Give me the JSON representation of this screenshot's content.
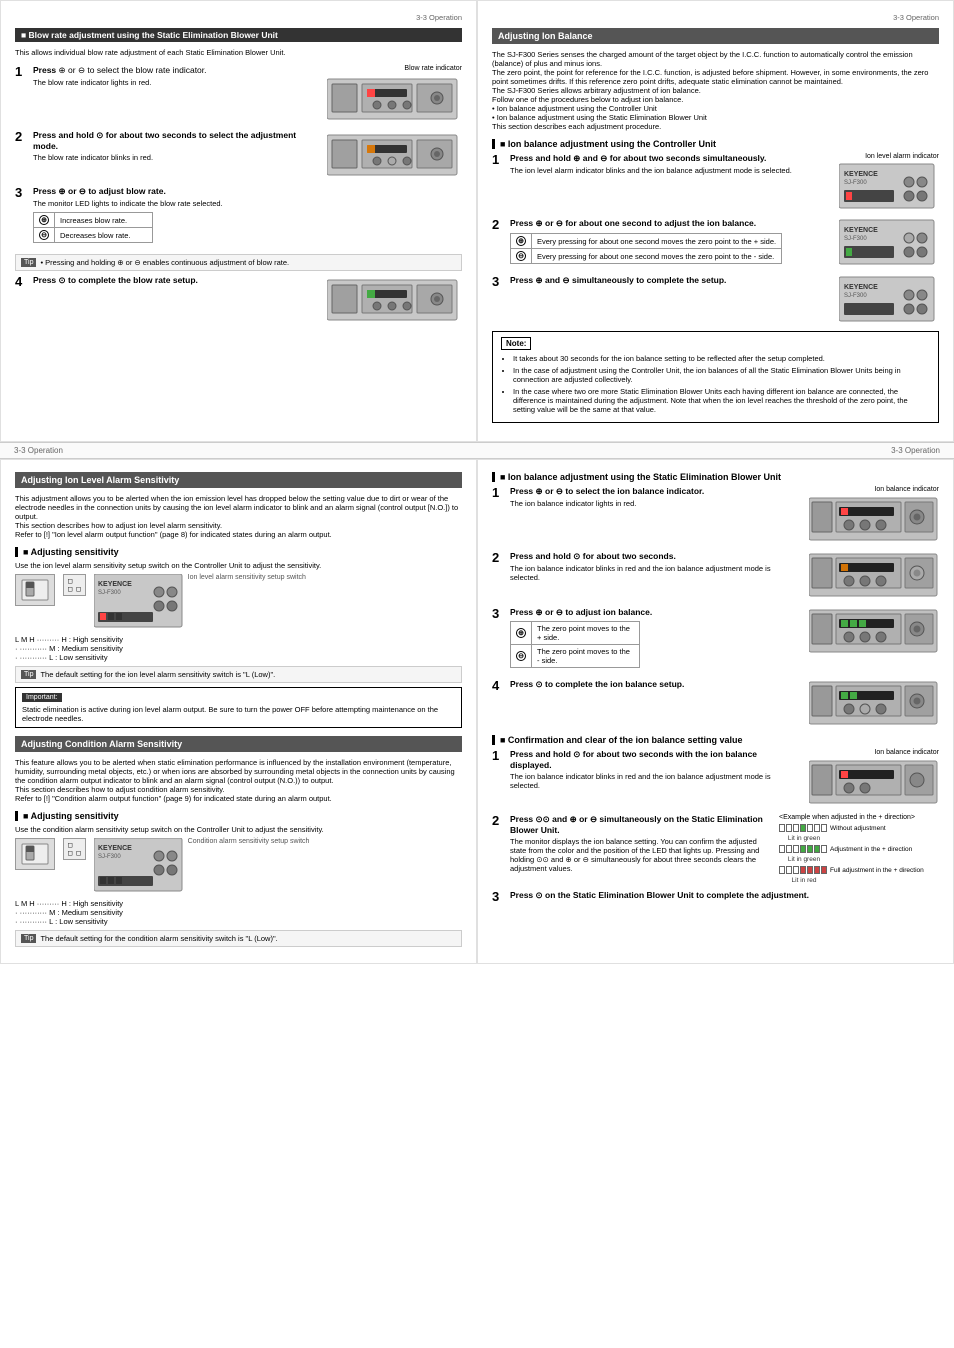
{
  "pages": {
    "top_left": {
      "header": "3-3  Operation",
      "section_title": "■ Blow rate adjustment using the Static Elimination Blower Unit",
      "section_desc": "This allows individual blow rate adjustment of each Static Elimination Blower Unit.",
      "blow_rate_indicator_label": "Blow rate indicator",
      "steps": [
        {
          "num": "1",
          "bold_text": "Press",
          "text": " ⊕ or ⊖ to select the blow rate indicator.",
          "sub": "The blow rate indicator lights in red."
        },
        {
          "num": "2",
          "bold_text": "Press and hold ⊙ for about two seconds to select the adjustment mode.",
          "text": "",
          "sub": "The blow rate indicator blinks in red."
        },
        {
          "num": "3",
          "bold_text": "Press ⊕ or ⊖ to adjust blow rate.",
          "text": "",
          "sub": "The monitor LED lights to indicate the blow rate selected."
        },
        {
          "num": "4",
          "bold_text": "Press ⊙ to complete the blow rate setup.",
          "text": "",
          "sub": ""
        }
      ],
      "table_rows": [
        {
          "icon": "⊕",
          "text": "Increases blow rate."
        },
        {
          "icon": "⊖",
          "text": "Decreases blow rate."
        }
      ],
      "tip_text": "• Pressing and holding ⊕ or ⊖ enables continuous adjustment of blow rate."
    },
    "top_right": {
      "header": "3-3  Operation",
      "section_title": "Adjusting Ion Balance",
      "section_desc_lines": [
        "The SJ-F300 Series senses the charged amount of the target object by the I.C.C. function to automatically control the emission (balance) of plus and minus ions.",
        "The zero point, the point for reference for the I.C.C. function, is adjusted before shipment. However, in some environments, the zero point sometimes drifts. If this reference zero point drifts, adequate static elimination cannot be maintained.",
        "The SJ-F300 Series allows arbitrary adjustment of ion balance.",
        "Follow one of the procedures below to adjust ion balance.",
        "• Ion balance adjustment using the Controller Unit",
        "• Ion balance adjustment using the Static Elimination Blower Unit",
        "This section describes each adjustment procedure."
      ],
      "controller_unit_title": "■ Ion balance adjustment using the Controller Unit",
      "controller_steps": [
        {
          "num": "1",
          "bold_text": "Press and hold ⊕ and ⊖ for about two seconds simultaneously.",
          "sub": "The ion level alarm indicator blinks and the ion balance adjustment mode is selected.",
          "indicator_label": "Ion level alarm indicator"
        },
        {
          "num": "2",
          "bold_text": "Press ⊕ or ⊖ for about one second to adjust the ion balance.",
          "sub": "",
          "table": [
            {
              "icon": "⊕",
              "text": "Every pressing for about one second moves the zero point to the + side."
            },
            {
              "icon": "⊖",
              "text": "Every pressing for about one second moves the zero point to the - side."
            }
          ]
        },
        {
          "num": "3",
          "bold_text": "Press ⊕ and ⊖ simultaneously to complete the setup.",
          "sub": ""
        }
      ],
      "note_title": "Note:",
      "note_bullets": [
        "It takes about 30 seconds for the ion balance setting to be reflected after the setup completed.",
        "In the case of adjustment using the Controller Unit, the ion balances of all the Static Elimination Blower Units being in connection are adjusted collectively.",
        "In the case where two ore more Static Elimination Blower Units each having different ion balance are connected, the difference is maintained during the adjustment. Note that when the ion level reaches the threshold of the zero point, the setting value will be the same at that value."
      ]
    },
    "middle_header_left": "3-3  Operation",
    "middle_header_right": "3-3  Operation",
    "bottom_left": {
      "section1_title": "Adjusting Ion Level Alarm Sensitivity",
      "section1_desc": "This adjustment allows you to be alerted when the ion emission level has dropped below the setting value due to dirt or wear of the electrode needles in the connection units by causing the ion level alarm indicator to blink and an alarm signal (control output [N.O.]) to output.\nThis section describes how to adjust ion level alarm sensitivity.\nRefer to [!] \"Ion level alarm output function\" (page 8) for indicated states during an alarm output.",
      "adj_sens_title": "■ Adjusting sensitivity",
      "adj_sens_desc": "Use the ion level alarm sensitivity setup switch on the Controller Unit to adjust the sensitivity.",
      "ion_level_switch_label": "Ion level alarm sensitivity setup switch",
      "switch_labels": [
        "L M H ·········  H : High sensitivity",
        "· ·············  M : Medium sensitivity",
        "· ·············  L : Low sensitivity"
      ],
      "tip2_text": "The default setting for the ion level alarm sensitivity switch is \"L (Low)\".",
      "important_title": "Important:",
      "important_text": "Static elimination is active during ion level alarm output. Be sure to turn the power OFF before attempting maintenance on the electrode needles.",
      "section2_title": "Adjusting Condition Alarm Sensitivity",
      "section2_desc": "This feature allows you to be alerted when static elimination performance is influenced by the installation environment (temperature, humidity, surrounding metal objects, etc.) or when ions are absorbed by surrounding metal objects in the connection units by causing the condition alarm output indicator to blink and an alarm signal (control output (N.O.)) to output.\nThis section describes how to adjust condition alarm sensitivity.\nRefer to [!] \"Condition alarm output function\" (page 9) for indicated state during an alarm output.",
      "adj_cond_title": "■ Adjusting sensitivity",
      "adj_cond_desc": "Use the condition alarm sensitivity setup switch on the Controller Unit to adjust the sensitivity.",
      "cond_switch_label": "Condition alarm sensitivity setup switch",
      "cond_switch_labels": [
        "L M H ·········  H : High sensitivity",
        "· ·············  M : Medium sensitivity",
        "· ·············  L : Low sensitivity"
      ],
      "tip3_text": "The default setting for the condition alarm sensitivity switch is \"L (Low)\"."
    },
    "bottom_right": {
      "blower_title": "■ Ion balance adjustment using the Static Elimination Blower Unit",
      "steps": [
        {
          "num": "1",
          "bold_text": "Press ⊕ or ⊖ to select the ion balance indicator.",
          "sub": "The ion balance indicator lights in red.",
          "indicator_label": "Ion balance indicator"
        },
        {
          "num": "2",
          "bold_text": "Press and hold ⊙ for about two seconds.",
          "sub": "The ion balance indicator blinks in red and the ion balance adjustment mode is selected."
        },
        {
          "num": "3",
          "bold_text": "Press ⊕ or ⊖ to adjust ion balance.",
          "sub": "",
          "table": [
            {
              "icon": "⊕",
              "text": "The zero point moves to the + side."
            },
            {
              "icon": "⊖",
              "text": "The zero point moves to the - side."
            }
          ]
        },
        {
          "num": "4",
          "bold_text": "Press ⊙ to complete the ion balance setup.",
          "sub": ""
        }
      ],
      "confirm_title": "■ Confirmation and clear of the ion balance setting value",
      "confirm_steps": [
        {
          "num": "1",
          "bold_text": "Press and hold ⊙ for about two seconds with the ion balance displayed.",
          "sub": "The ion balance indicator blinks in red and the ion balance adjustment mode is selected.",
          "indicator_label": "Ion balance indicator"
        },
        {
          "num": "2",
          "bold_text": "Press ⊙⊙ and ⊕ or ⊖ simultaneously on the Static Elimination Blower Unit.",
          "sub": "The monitor displays the ion balance setting. You can confirm the adjusted state from the color and the position of the LED that lights up. Pressing and holding ⊙⊙ and ⊕ or ⊖ simultaneously for about three seconds clears the adjustment values.",
          "example_label": "<Example when adjusted in the + direction>",
          "bars": [
            {
              "type": "empty",
              "label": "Without adjustment",
              "color": "green"
            },
            {
              "type": "plus",
              "label": "Adjustment in the + direction",
              "color": "green"
            },
            {
              "type": "minus",
              "label": "Full adjustment in the + direction",
              "color": "red"
            }
          ]
        },
        {
          "num": "3",
          "bold_text": "Press ⊙ on the Static Elimination Blower Unit to complete the adjustment.",
          "sub": ""
        }
      ]
    }
  }
}
